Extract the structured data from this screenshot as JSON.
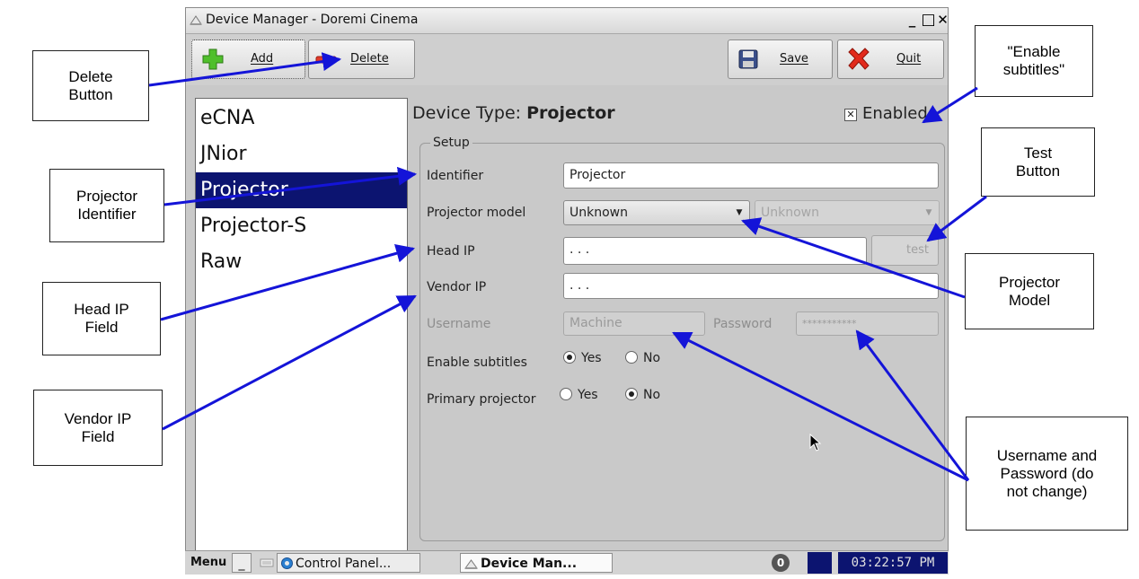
{
  "window": {
    "title": "Device Manager - Doremi Cinema",
    "controls": {
      "minimize": "_",
      "maximize": "□",
      "close": "✕"
    }
  },
  "toolbar": {
    "add_label": "Add",
    "delete_label": "Delete",
    "save_label": "Save",
    "quit_label": "Quit"
  },
  "device_list": {
    "items": [
      "eCNA",
      "JNior",
      "Projector",
      "Projector-S",
      "Raw"
    ],
    "selected": "Projector"
  },
  "details": {
    "device_type_label": "Device Type: ",
    "device_type_value": "Projector",
    "enabled_label": "Enabled",
    "enabled_checked": true,
    "setup_legend": "Setup",
    "identifier_label": "Identifier",
    "identifier_value": "Projector",
    "projector_model_label": "Projector model",
    "projector_model_value": "Unknown",
    "projector_model_secondary_value": "Unknown",
    "head_ip_label": "Head IP",
    "head_ip_value": " .  .  .",
    "test_label": "test",
    "vendor_ip_label": "Vendor IP",
    "vendor_ip_value": " .  .  .",
    "username_label": "Username",
    "username_value": "Machine",
    "password_label": "Password",
    "password_value": "***********",
    "enable_subtitles_label": "Enable subtitles",
    "enable_subtitles_yes": "Yes",
    "enable_subtitles_no": "No",
    "enable_subtitles_selected": "Yes",
    "primary_projector_label": "Primary projector",
    "primary_projector_yes": "Yes",
    "primary_projector_no": "No",
    "primary_projector_selected": "No"
  },
  "taskbar": {
    "menu_label": "Menu",
    "minimize_label": "_",
    "control_panel_label": "Control Panel...",
    "device_manager_label": "Device Man...",
    "notification_count": "0",
    "clock": "03:22:57 PM"
  },
  "annotations": {
    "delete_button": "Delete\nButton",
    "projector_identifier": "Projector\nIdentifier",
    "head_ip_field": "Head IP\nField",
    "vendor_ip_field": "Vendor IP\nField",
    "enable_subtitles": "\"Enable\nsubtitles\"",
    "test_button": "Test\nButton",
    "projector_model": "Projector\nModel",
    "username_password": "Username and\nPassword (do\nnot change)"
  },
  "colors": {
    "selection": "#0c1470",
    "annotation_arrow": "#1414d8",
    "window_bg": "#c9c9c9"
  }
}
